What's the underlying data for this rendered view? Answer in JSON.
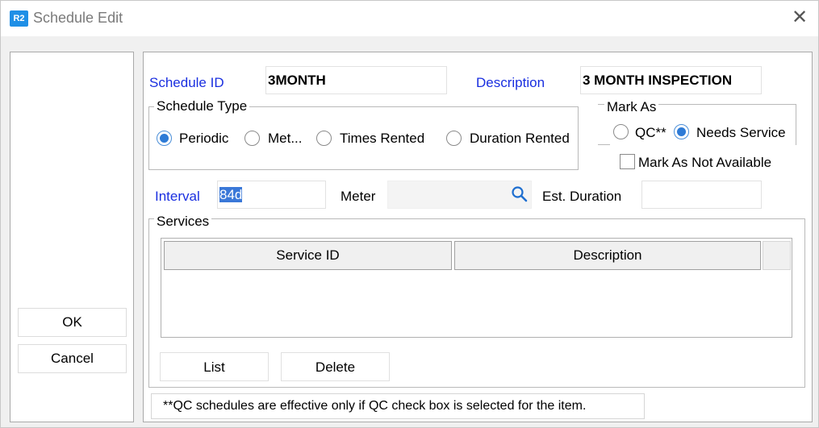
{
  "window": {
    "title": "Schedule Edit",
    "app_badge": "R2",
    "close_glyph": "✕"
  },
  "buttons": {
    "ok": "OK",
    "cancel": "Cancel",
    "list": "List",
    "delete": "Delete"
  },
  "form": {
    "schedule_id_label": "Schedule ID",
    "schedule_id_value": "3MONTH",
    "description_label": "Description",
    "description_value": "3 MONTH INSPECTION",
    "interval_label": "Interval",
    "interval_value": "84d",
    "meter_label": "Meter",
    "meter_value": "",
    "est_duration_label": "Est.  Duration",
    "est_duration_value": ""
  },
  "schedule_type": {
    "legend": "Schedule Type",
    "options": [
      "Periodic",
      "Met...",
      "Times Rented",
      "Duration Rented"
    ],
    "selected": "Periodic"
  },
  "mark_as": {
    "legend": "Mark As",
    "options": [
      "QC**",
      "Needs Service"
    ],
    "selected": "Needs Service",
    "not_available_label": "Mark As Not Available",
    "not_available_checked": false
  },
  "services": {
    "legend": "Services",
    "columns": [
      "Service ID",
      "Description"
    ],
    "rows": []
  },
  "note": "**QC schedules are effective only if QC check box is selected for the item.",
  "colors": {
    "label_blue": "#1a2fe0",
    "selection": "#3a78d8",
    "radio_on": "#2e7bd6",
    "app_icon": "#1f8fe6"
  }
}
